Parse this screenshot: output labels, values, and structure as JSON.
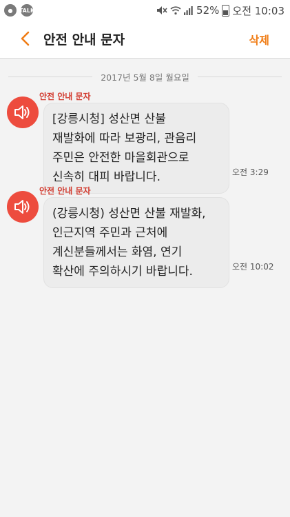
{
  "status_bar": {
    "battery": "52%",
    "time": "오전 10:03",
    "kakaotalk_badge": "TALK"
  },
  "header": {
    "title": "안전 안내 문자",
    "delete_label": "삭제"
  },
  "date_divider": "2017년 5월 8일 월요일",
  "messages": [
    {
      "sender": "안전 안내 문자",
      "text": "[강릉시청] 성산면 산불\n재발화에 따라 보광리, 관음리\n주민은 안전한 마을회관으로\n신속히 대피 바랍니다.",
      "time": "오전 3:29"
    },
    {
      "sender": "안전 안내 문자",
      "text": "(강릉시청) 성산면 산불 재발화,\n인근지역 주민과 근처에\n계신분들께서는 화염, 연기\n확산에 주의하시기 바랍니다.",
      "time": "오전 10:02"
    }
  ],
  "colors": {
    "accent": "#f07d16",
    "alert_red": "#ed4c3e",
    "sender_red": "#d23a2e",
    "bubble": "#ececec",
    "background": "#f3f3f3"
  },
  "icons": {
    "back": "chevron-left-icon",
    "alert": "speaker-icon"
  }
}
